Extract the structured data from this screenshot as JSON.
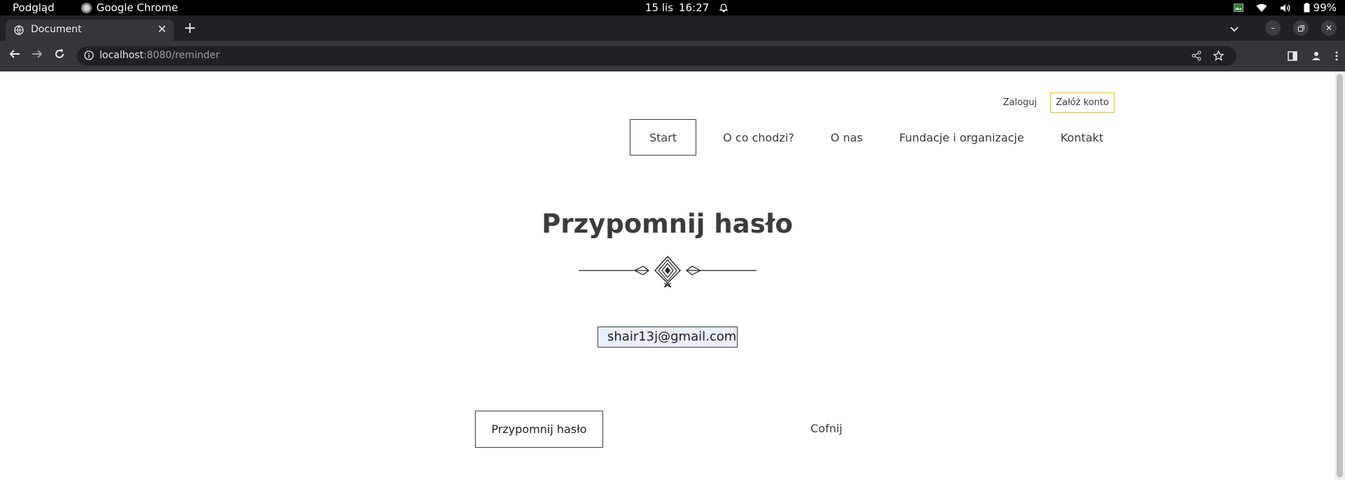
{
  "os_bar": {
    "app_menu": "Podgląd",
    "active_app": "Google Chrome",
    "date": "15 lis",
    "time": "16:27",
    "battery": "99%",
    "icons": [
      "tray-app-icon",
      "wifi-icon",
      "volume-icon",
      "battery-icon",
      "alarm-icon"
    ]
  },
  "browser": {
    "tab_title": "Document",
    "url_host": "localhost",
    "url_rest": ":8080/reminder",
    "icons": [
      "globe-icon",
      "close-icon",
      "plus-icon",
      "chevron-down-icon",
      "minimize-icon",
      "restore-icon",
      "close-icon",
      "back-arrow-icon",
      "forward-arrow-icon",
      "reload-icon",
      "info-icon",
      "share-icon",
      "star-icon",
      "side-panel-icon",
      "profile-icon",
      "kebab-menu-icon"
    ]
  },
  "page": {
    "auth": {
      "login": "Zaloguj",
      "register": "Załóż konto",
      "register_border_color": "#f2c200"
    },
    "nav": [
      "Start",
      "O co chodzi?",
      "O nas",
      "Fundacje i organizacje",
      "Kontakt"
    ],
    "title": "Przypomnij hasło",
    "email_value": "shair13j@gmail.com",
    "submit_label": "Przypomnij hasło",
    "back_label": "Cofnij",
    "autofill_color": "#e8f0fe"
  }
}
